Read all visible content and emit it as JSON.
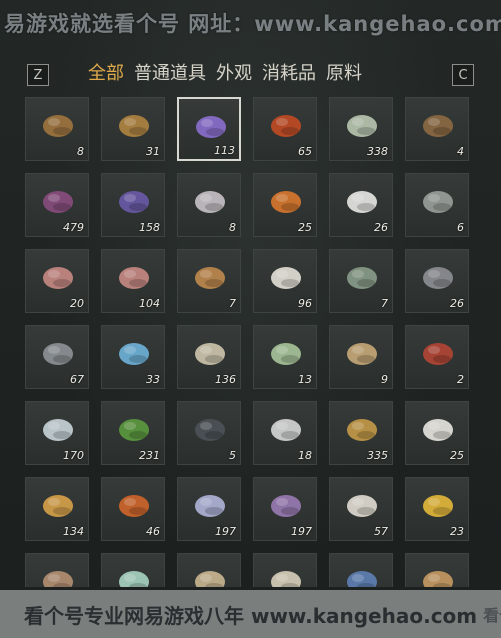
{
  "watermark_top": "易游戏就选看个号 网址：www.kangehao.com",
  "topbar": {
    "left_key": "Z",
    "right_key": "C",
    "tabs": [
      {
        "label": "全部",
        "active": true
      },
      {
        "label": "普通道具",
        "active": false
      },
      {
        "label": "外观",
        "active": false
      },
      {
        "label": "消耗品",
        "active": false
      },
      {
        "label": "原料",
        "active": false
      }
    ]
  },
  "items": [
    {
      "icon": "fish-icon",
      "count": "8",
      "color": "#a0743e"
    },
    {
      "icon": "ore-chunk-icon",
      "count": "31",
      "color": "#b08440"
    },
    {
      "icon": "amethyst-crystal-icon",
      "count": "113",
      "color": "#8c6fcf",
      "selected": true
    },
    {
      "icon": "red-jade-stone-icon",
      "count": "65",
      "color": "#c24a24"
    },
    {
      "icon": "white-flower-herb-icon",
      "count": "338",
      "color": "#b9c7b0"
    },
    {
      "icon": "bowl-of-grain-icon",
      "count": "4",
      "color": "#8d6a42"
    },
    {
      "icon": "purple-flower-icon",
      "count": "479",
      "color": "#8a4d7e"
    },
    {
      "icon": "lavender-herb-icon",
      "count": "158",
      "color": "#6a5aa8"
    },
    {
      "icon": "white-sprig-icon",
      "count": "8",
      "color": "#c9c2c8"
    },
    {
      "icon": "orange-flower-icon",
      "count": "25",
      "color": "#d9782e"
    },
    {
      "icon": "white-feather-icon",
      "count": "26",
      "color": "#e8e8e3"
    },
    {
      "icon": "grey-branch-icon",
      "count": "6",
      "color": "#9aa09a"
    },
    {
      "icon": "raw-meat-icon",
      "count": "20",
      "color": "#c98a84"
    },
    {
      "icon": "raw-meat-icon",
      "count": "104",
      "color": "#c98a84"
    },
    {
      "icon": "brown-fur-icon",
      "count": "7",
      "color": "#c08a4e"
    },
    {
      "icon": "white-fur-icon",
      "count": "96",
      "color": "#e4e0d6"
    },
    {
      "icon": "small-fish-icon",
      "count": "7",
      "color": "#8a9c8a"
    },
    {
      "icon": "dark-ore-icon",
      "count": "26",
      "color": "#8d8f93"
    },
    {
      "icon": "grey-ore-icon",
      "count": "67",
      "color": "#8e9297"
    },
    {
      "icon": "blue-crystal-ore-icon",
      "count": "33",
      "color": "#6fb2d9"
    },
    {
      "icon": "bone-icon",
      "count": "136",
      "color": "#cfc5ad"
    },
    {
      "icon": "green-melon-icon",
      "count": "13",
      "color": "#a7c49a"
    },
    {
      "icon": "bundled-sacks-icon",
      "count": "9",
      "color": "#c7a878"
    },
    {
      "icon": "red-berry-branch-icon",
      "count": "2",
      "color": "#b34534"
    },
    {
      "icon": "white-blossom-herb-icon",
      "count": "170",
      "color": "#c9d4d9"
    },
    {
      "icon": "green-leaf-herb-icon",
      "count": "231",
      "color": "#5c9a3e"
    },
    {
      "icon": "dark-feather-icon",
      "count": "5",
      "color": "#4d5258"
    },
    {
      "icon": "black-white-feather-icon",
      "count": "18",
      "color": "#d6d6d6"
    },
    {
      "icon": "golden-shell-icon",
      "count": "335",
      "color": "#c59a48"
    },
    {
      "icon": "bowl-of-milk-icon",
      "count": "25",
      "color": "#e8e6df"
    },
    {
      "icon": "gold-nuggets-icon",
      "count": "134",
      "color": "#d8a24a"
    },
    {
      "icon": "orange-seed-icon",
      "count": "46",
      "color": "#d0652a"
    },
    {
      "icon": "spiky-flower-icon",
      "count": "197",
      "color": "#b0b4d8"
    },
    {
      "icon": "purple-spike-flower-icon",
      "count": "197",
      "color": "#9a7bb5"
    },
    {
      "icon": "white-rose-icon",
      "count": "57",
      "color": "#e2ddd3"
    },
    {
      "icon": "yellow-flower-herb-icon",
      "count": "23",
      "color": "#e4b83a"
    },
    {
      "icon": "root-plant-icon",
      "count": "",
      "color": "#b59072"
    },
    {
      "icon": "paper-packets-icon",
      "count": "",
      "color": "#a9d4c2"
    },
    {
      "icon": "scroll-icon",
      "count": "",
      "color": "#cbb791"
    },
    {
      "icon": "ceramic-jar-icon",
      "count": "",
      "color": "#d7cfb9"
    },
    {
      "icon": "horn-icon",
      "count": "",
      "color": "#5e7fb5"
    },
    {
      "icon": "curved-horn-icon",
      "count": "",
      "color": "#c69a62"
    }
  ],
  "watermark_bottom": "看个号专业网易游戏八年 www.kangehao.com",
  "watermark_bottom_mark": "看个号"
}
